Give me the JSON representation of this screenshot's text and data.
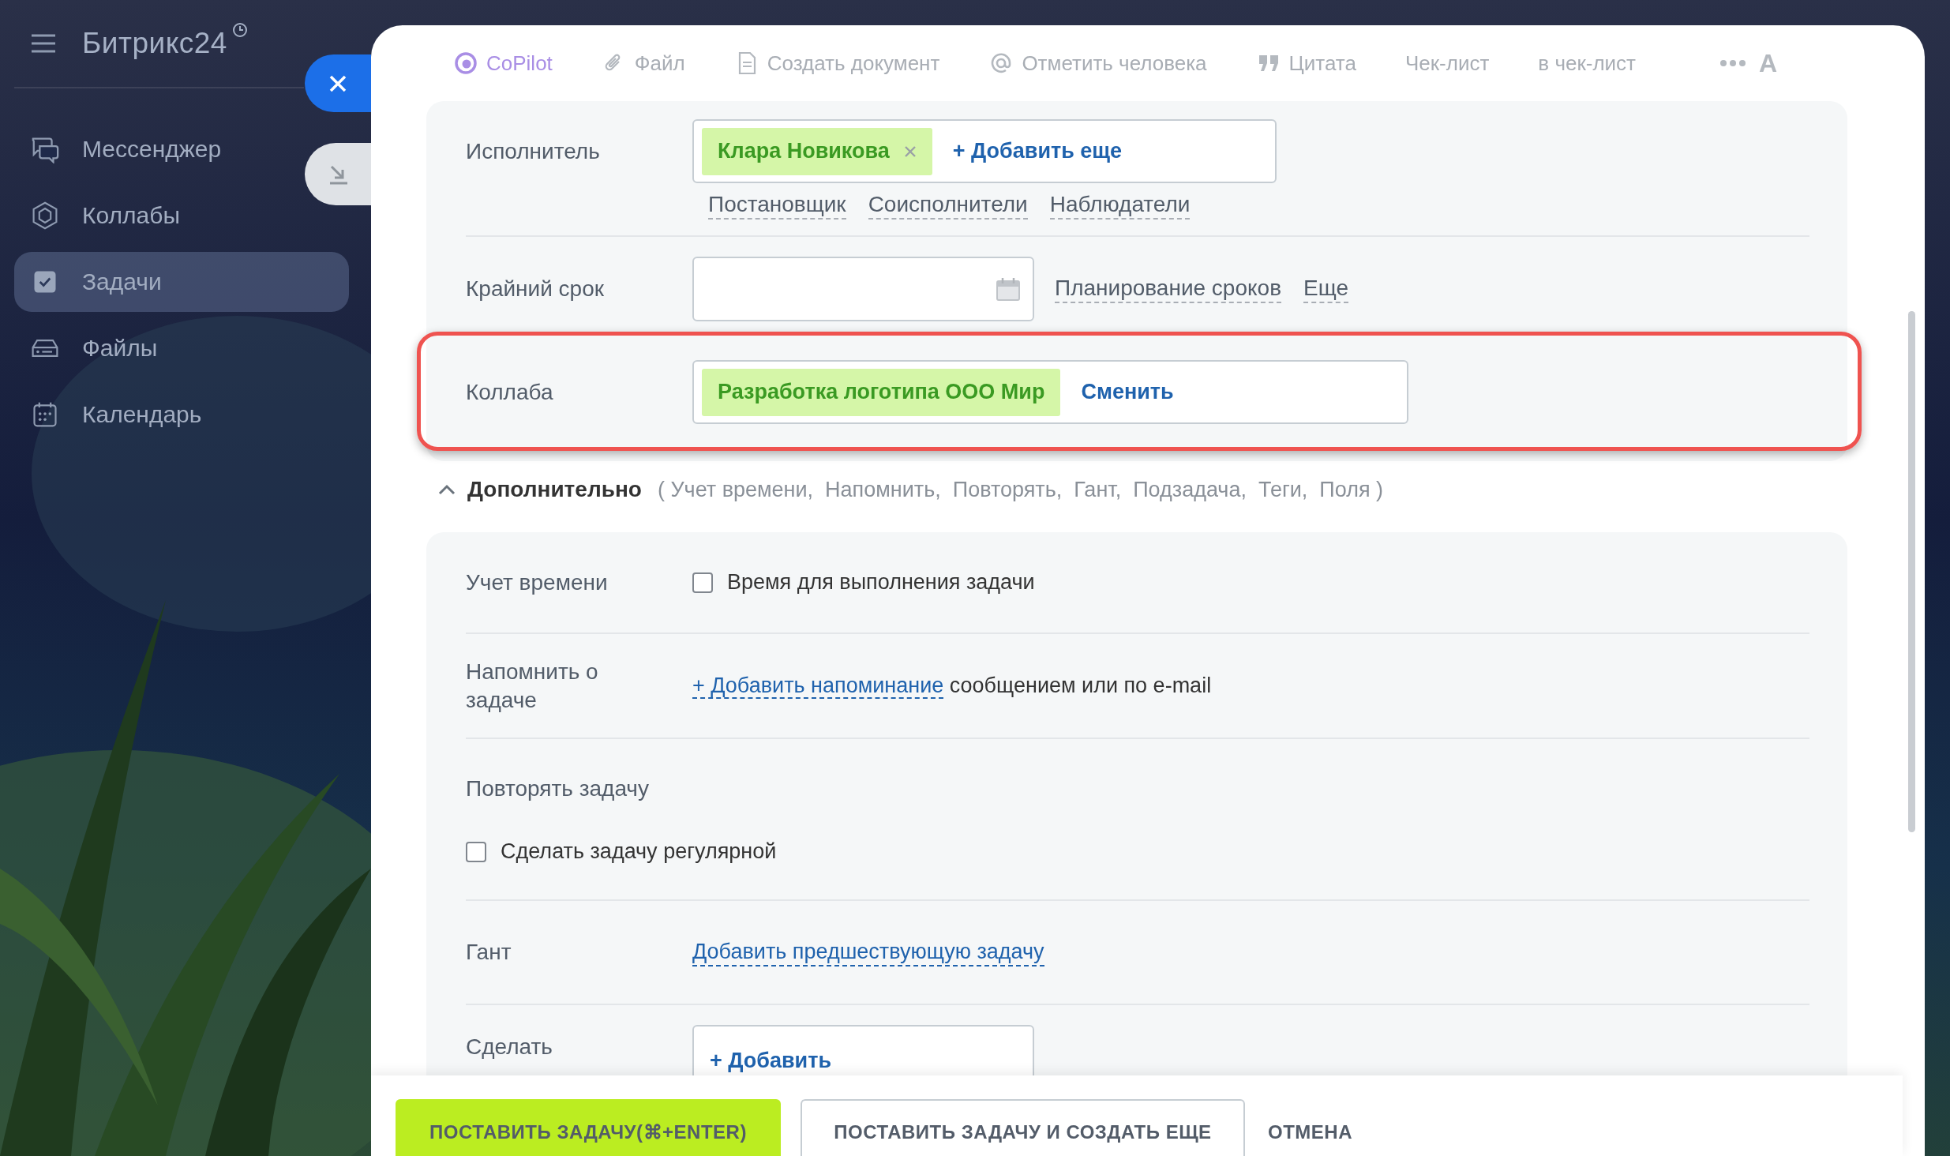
{
  "sidebar": {
    "logo": "Битрикс24",
    "items": [
      {
        "label": "Мессенджер",
        "selected": false
      },
      {
        "label": "Коллабы",
        "selected": false
      },
      {
        "label": "Задачи",
        "selected": true
      },
      {
        "label": "Файлы",
        "selected": false
      },
      {
        "label": "Календарь",
        "selected": false
      }
    ]
  },
  "toolbar": {
    "items": [
      {
        "kind": "copilot",
        "label": "CoPilot"
      },
      {
        "kind": "file",
        "label": "Файл"
      },
      {
        "kind": "document",
        "label": "Создать документ"
      },
      {
        "kind": "mention",
        "label": "Отметить человека"
      },
      {
        "kind": "quote",
        "label": "Цитата"
      },
      {
        "kind": "plain",
        "label": "Чек-лист"
      },
      {
        "kind": "plain",
        "label": "в чек-лист"
      }
    ],
    "format_label": "A"
  },
  "assignee": {
    "label": "Исполнитель",
    "chips": [
      {
        "text": "Клара Новикова"
      }
    ],
    "add_link": "+ Добавить еще",
    "roles": [
      "Постановщик",
      "Соисполнители",
      "Наблюдатели"
    ]
  },
  "deadline": {
    "label": "Крайний срок",
    "links": [
      "Планирование сроков",
      "Еще"
    ]
  },
  "collab": {
    "label": "Коллаба",
    "chip": "Разработка логотипа ООО Мир",
    "change_link": "Сменить",
    "highlighted": true
  },
  "extra": {
    "title": "Дополнительно",
    "expanded": true,
    "summary": "( Учет времени,  Напомнить,  Повторять,  Гант,  Подзадача,  Теги,  Поля )"
  },
  "extra_rows": [
    {
      "kind": "checkbox",
      "label": "Учет времени",
      "text": "Время для выполнения задачи",
      "checked": false
    },
    {
      "kind": "reminder",
      "label": "Напомнить о задаче",
      "link": "+ Добавить напоминание",
      "text": "сообщением или по e-mail"
    },
    {
      "kind": "repeat",
      "label": "Повторять задачу",
      "text": "Сделать задачу регулярной",
      "checked": false
    },
    {
      "kind": "link",
      "label": "Гант",
      "link": "Добавить предшествующую задачу"
    },
    {
      "kind": "add",
      "label": "Сделать",
      "button": "+ Добавить"
    }
  ],
  "footer": {
    "buttons": [
      {
        "kind": "primary",
        "label": "ПОСТАВИТЬ ЗАДАЧУ(⌘+ENTER)"
      },
      {
        "kind": "secondary",
        "label": "ПОСТАВИТЬ ЗАДАЧУ И СОЗДАТЬ ЕЩЕ"
      },
      {
        "kind": "plain",
        "label": "ОТМЕНА"
      }
    ]
  }
}
